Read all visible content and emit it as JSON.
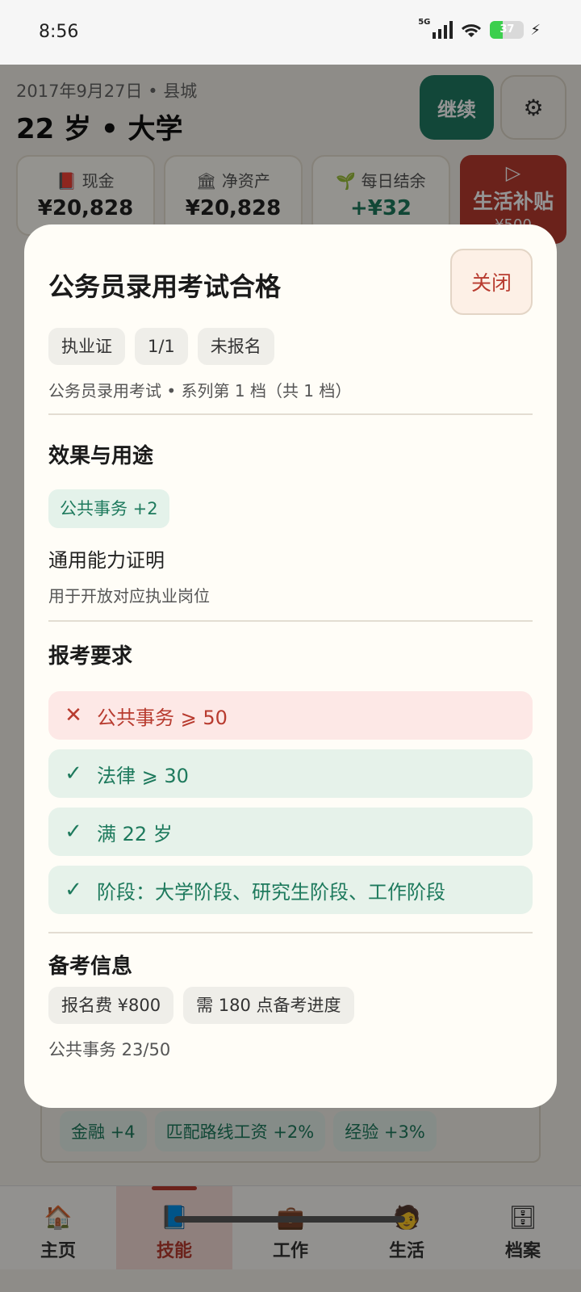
{
  "status_bar": {
    "time": "8:56",
    "network": "5G",
    "battery": "37",
    "battery_level": 0.37
  },
  "header": {
    "date": "2017年9月27日 • 县城",
    "age_stage": "22 岁 • 大学",
    "continue_label": "继续",
    "settings_icon": "gear-icon"
  },
  "stats": [
    {
      "icon": "📕",
      "label": "现金",
      "value": "¥20,828"
    },
    {
      "icon": "🏛",
      "label": "净资产",
      "value": "¥20,828"
    },
    {
      "icon": "🌱",
      "label": "每日结余",
      "value": "+¥32"
    }
  ],
  "subsidy": {
    "label": "生活补贴",
    "sub": "¥500"
  },
  "background_chips": [
    "金融 +4",
    "匹配路线工资 +2%",
    "经验 +3%"
  ],
  "nav": [
    {
      "icon": "🏠",
      "label": "主页"
    },
    {
      "icon": "📘",
      "label": "技能"
    },
    {
      "icon": "💼",
      "label": "工作"
    },
    {
      "icon": "🧑",
      "label": "生活"
    },
    {
      "icon": "🗄",
      "label": "档案"
    }
  ],
  "modal": {
    "title": "公务员录用考试合格",
    "close_label": "关闭",
    "tags": [
      "执业证",
      "1/1",
      "未报名"
    ],
    "meta": "公务员录用考试 • 系列第 1 档（共 1 档）",
    "effects": {
      "title": "效果与用途",
      "chip": "公共事务 +2",
      "main": "通用能力证明",
      "desc": "用于开放对应执业岗位"
    },
    "requirements": {
      "title": "报考要求",
      "items": [
        {
          "status": "fail",
          "mark": "✕",
          "text": "公共事务 ⩾ 50"
        },
        {
          "status": "ok",
          "mark": "✓",
          "text": "法律 ⩾ 30"
        },
        {
          "status": "ok",
          "mark": "✓",
          "text": "满 22 岁"
        },
        {
          "status": "ok",
          "mark": "✓",
          "text": "阶段：大学阶段、研究生阶段、工作阶段"
        }
      ]
    },
    "prep": {
      "title": "备考信息",
      "tags": [
        "报名费 ¥800",
        "需 180 点备考进度"
      ],
      "note": "公共事务 23/50"
    }
  }
}
